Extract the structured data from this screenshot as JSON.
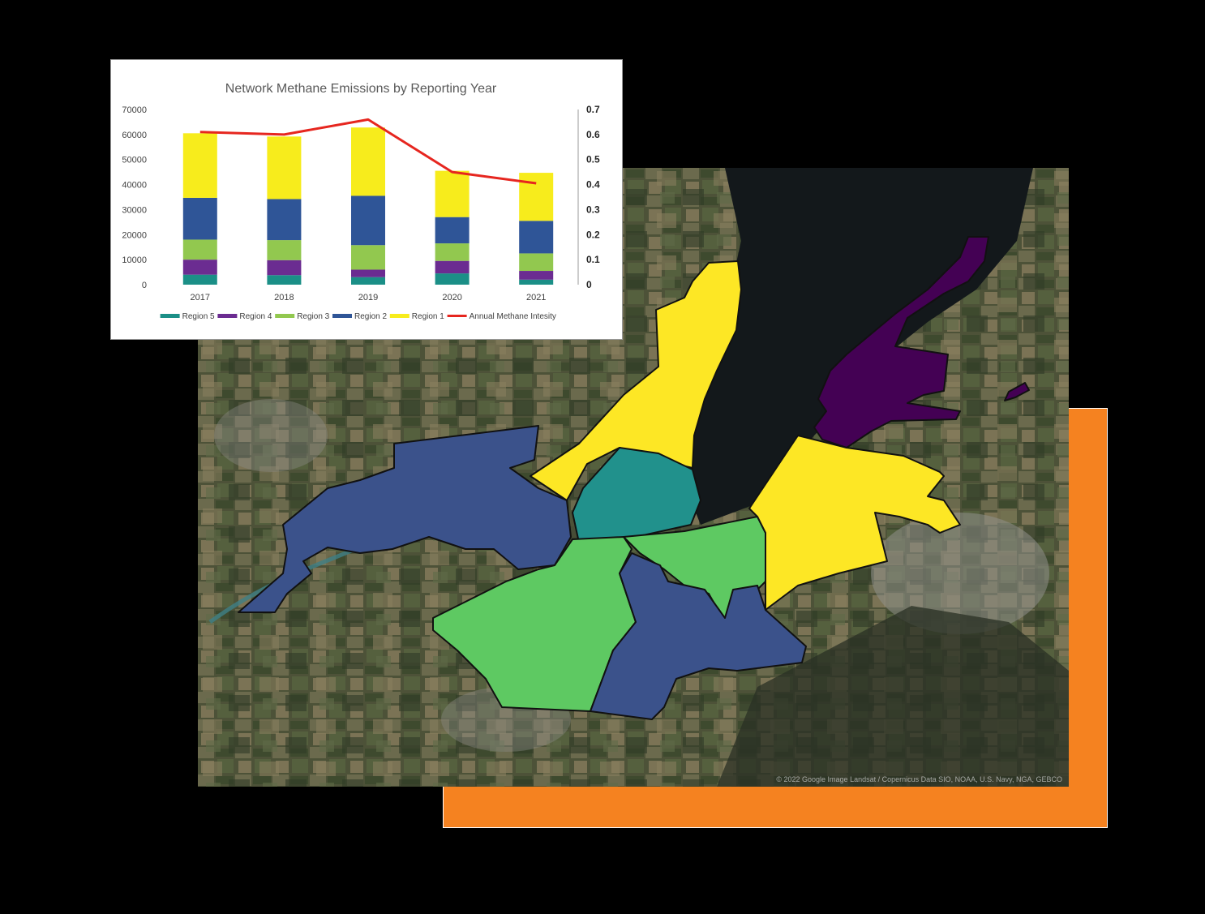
{
  "colors": {
    "background": "#000000",
    "accent_panel": "#f58220",
    "region5": "#1b8f87",
    "region4": "#6b2c91",
    "region3": "#92c84f",
    "region2": "#2f5597",
    "region1": "#f7ec1c",
    "intensity_line": "#e6261f",
    "map_region1": "#fde725",
    "map_region2": "#3b528b",
    "map_region3": "#5ec962",
    "map_region4": "#440154",
    "map_region5": "#21918c"
  },
  "map": {
    "attribution": "© 2022 Google  Image Landsat / Copernicus  Data SIO, NOAA, U.S. Navy, NGA, GEBCO"
  },
  "chart_data": {
    "type": "bar",
    "stacked": true,
    "title": "Network Methane Emissions by Reporting Year",
    "categories": [
      "2017",
      "2018",
      "2019",
      "2020",
      "2021"
    ],
    "series": [
      {
        "name": "Region 5",
        "color": "#1b8f87",
        "values": [
          4000,
          3800,
          3000,
          4500,
          2000
        ]
      },
      {
        "name": "Region 4",
        "color": "#6b2c91",
        "values": [
          6000,
          6000,
          3000,
          5000,
          3500
        ]
      },
      {
        "name": "Region 3",
        "color": "#92c84f",
        "values": [
          8000,
          8000,
          9800,
          7000,
          7000
        ]
      },
      {
        "name": "Region 2",
        "color": "#2f5597",
        "values": [
          16700,
          16400,
          19700,
          10500,
          13000
        ]
      },
      {
        "name": "Region 1",
        "color": "#f7ec1c",
        "values": [
          25800,
          25000,
          27300,
          18500,
          19200
        ]
      }
    ],
    "line_series": {
      "name": "Annual Methane Intesity",
      "color": "#e6261f",
      "axis": "right",
      "values": [
        0.61,
        0.6,
        0.66,
        0.45,
        0.405
      ]
    },
    "ylim": [
      0,
      70000
    ],
    "y_ticks": [
      0,
      10000,
      20000,
      30000,
      40000,
      50000,
      60000,
      70000
    ],
    "y2lim": [
      0,
      0.7
    ],
    "y2_ticks": [
      "0",
      "0.1",
      "0.2",
      "0.3",
      "0.4",
      "0.5",
      "0.6",
      "0.7"
    ],
    "legend_position": "bottom",
    "grid": false
  }
}
